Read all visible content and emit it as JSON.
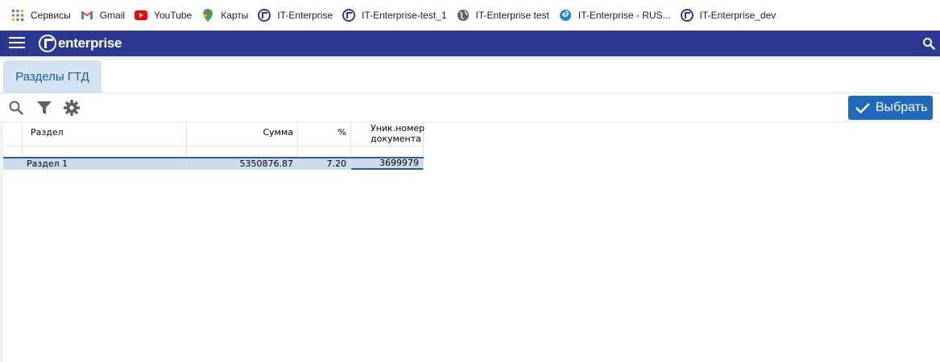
{
  "bookmarks": [
    {
      "label": "Сервисы",
      "icon": "apps-grid-icon"
    },
    {
      "label": "Gmail",
      "icon": "gmail-icon"
    },
    {
      "label": "YouTube",
      "icon": "youtube-icon"
    },
    {
      "label": "Карты",
      "icon": "maps-pin-icon"
    },
    {
      "label": "IT-Enterprise",
      "icon": "it-enterprise-icon"
    },
    {
      "label": "IT-Enterprise-test_1",
      "icon": "it-enterprise-icon"
    },
    {
      "label": "IT-Enterprise test",
      "icon": "globe-icon"
    },
    {
      "label": "IT-Enterprise - RUS...",
      "icon": "swirl-icon"
    },
    {
      "label": "IT-Enterprise_dev",
      "icon": "it-enterprise-icon"
    }
  ],
  "header": {
    "logo_text": "enterprise",
    "bg_color": "#2b3990"
  },
  "tab": {
    "label": "Разделы ГТД"
  },
  "toolbar": {
    "select_label": "Выбрать",
    "accent_color": "#1f69bf"
  },
  "grid": {
    "columns": [
      "Раздел",
      "Сумма",
      "%",
      "Уник.номер документа"
    ],
    "rows": [
      [
        "Раздел 1",
        "5350876.87",
        "7.20",
        "3699979"
      ]
    ]
  }
}
